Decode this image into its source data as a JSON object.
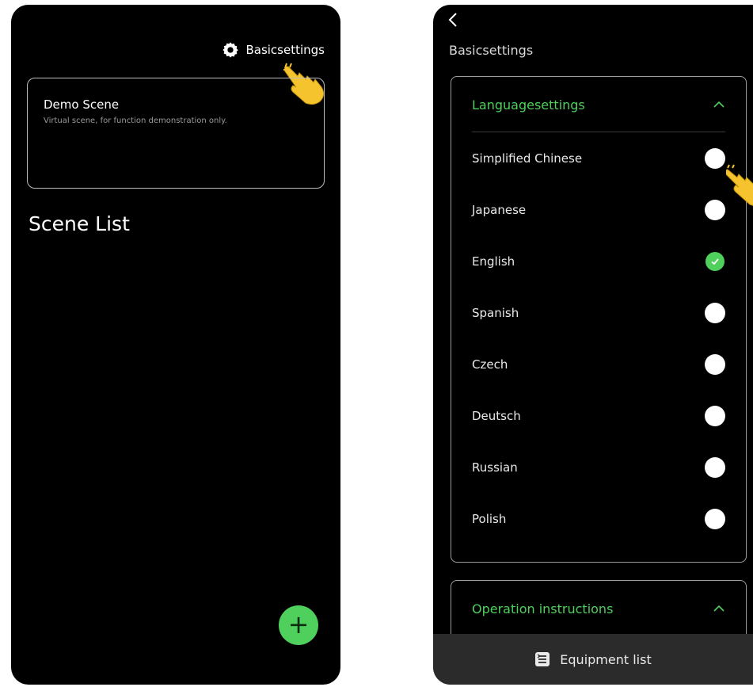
{
  "left": {
    "settings_label": "Basicsettings",
    "demo_card": {
      "title": "Demo Scene",
      "subtitle": "Virtual scene, for function demonstration only."
    },
    "scene_list_title": "Scene List",
    "fab_symbol": "+"
  },
  "right": {
    "page_title": "Basicsettings",
    "language_section": {
      "title": "Languagesettings",
      "languages": [
        {
          "name": "Simplified Chinese",
          "selected": false
        },
        {
          "name": "Japanese",
          "selected": false
        },
        {
          "name": "English",
          "selected": true
        },
        {
          "name": "Spanish",
          "selected": false
        },
        {
          "name": "Czech",
          "selected": false
        },
        {
          "name": "Deutsch",
          "selected": false
        },
        {
          "name": "Russian",
          "selected": false
        },
        {
          "name": "Polish",
          "selected": false
        }
      ]
    },
    "operation_section": {
      "title": "Operation instructions"
    },
    "bottom_bar_label": "Equipment list"
  },
  "colors": {
    "accent": "#4fcf5c",
    "background": "#000000",
    "bottom_bar": "#2b2b2b"
  },
  "icons": {
    "settings": "gear-icon",
    "back": "chevron-left-icon",
    "collapse": "chevron-up-icon",
    "fab": "plus-icon",
    "bottom_bar": "list-icon",
    "pointer": "pointing-hand-icon"
  }
}
